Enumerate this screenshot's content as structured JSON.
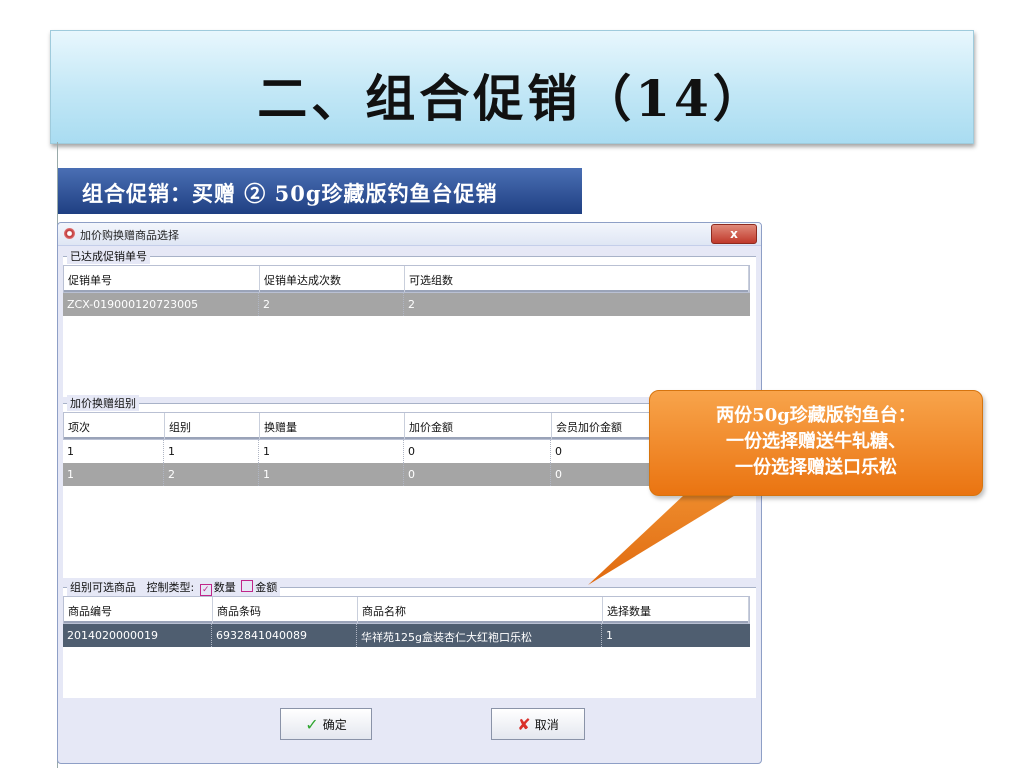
{
  "slide": {
    "title": "二、组合促销（14）",
    "subtitle": "组合促销：买赠 ② 50g珍藏版钓鱼台促销"
  },
  "dialog": {
    "title": "加价购换赠商品选择",
    "close_label": "x",
    "section1": {
      "label": "已达成促销单号",
      "headers": [
        "促销单号",
        "促销单达成次数",
        "可选组数"
      ],
      "rows": [
        [
          "ZCX-019000120723005",
          "2",
          "2"
        ]
      ]
    },
    "section2": {
      "label": "加价换赠组别",
      "headers": [
        "项次",
        "组别",
        "换赠量",
        "加价金额",
        "会员加价金额"
      ],
      "rows": [
        [
          "1",
          "1",
          "1",
          "0",
          "0"
        ],
        [
          "1",
          "2",
          "1",
          "0",
          "0"
        ]
      ]
    },
    "section3": {
      "label": "组别可选商品",
      "control_type_label": "控制类型:",
      "option_qty": "数量",
      "option_amount": "金额",
      "headers": [
        "商品编号",
        "商品条码",
        "商品名称",
        "选择数量"
      ],
      "rows": [
        [
          "2014020000019",
          "6932841040089",
          "华祥苑125g盒装杏仁大红袍口乐松",
          "1"
        ]
      ]
    },
    "ok_label": "确定",
    "cancel_label": "取消"
  },
  "callout": {
    "line1": "两份50g珍藏版钓鱼台：",
    "line2": "一份选择赠送牛轧糖、",
    "line3": "一份选择赠送口乐松"
  },
  "colors": {
    "banner": "#c2e7f6",
    "subtitle_band": "#2a4b8f",
    "callout": "#f28a26",
    "selected_row": "#a5a5a5",
    "selected_row_dark": "#4f5e70"
  }
}
